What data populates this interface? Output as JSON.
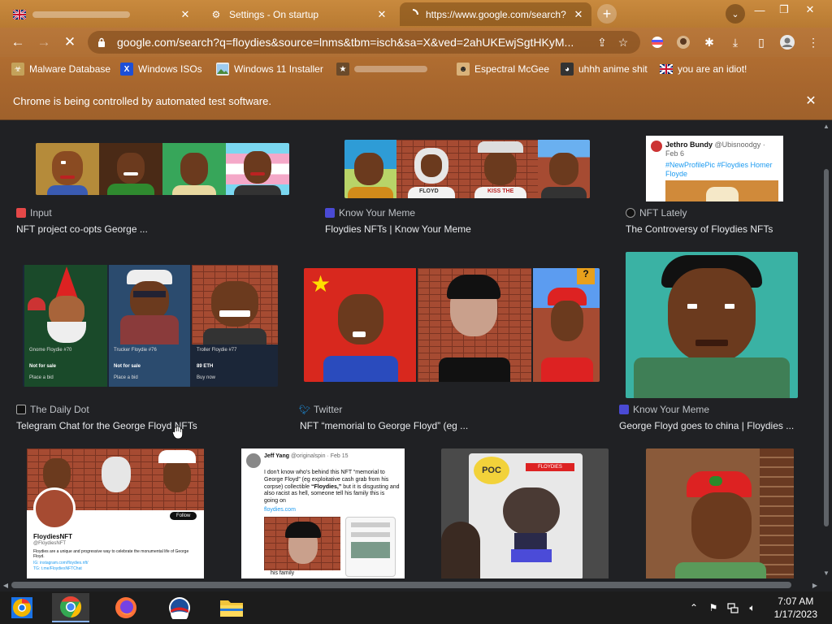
{
  "tabs": [
    {
      "title": "",
      "state": "background",
      "favicon": "flag-icon"
    },
    {
      "title": "Settings - On startup",
      "state": "background",
      "favicon": "gear-icon"
    },
    {
      "title": "https://www.google.com/search?",
      "state": "active-loading",
      "favicon": "spinner-icon"
    }
  ],
  "toolbar": {
    "url": "google.com/search?q=floydies&source=lnms&tbm=isch&sa=X&ved=2ahUKEwjSgtHKyM..."
  },
  "bookmarks": [
    {
      "label": "Malware Database",
      "icon": "malware-icon",
      "color": "#c4a25a"
    },
    {
      "label": "Windows ISOs",
      "icon": "x-icon",
      "color": "#1c4fd8"
    },
    {
      "label": "Windows 11 Installer",
      "icon": "image-icon",
      "color": "#4c8a3b"
    },
    {
      "label": "",
      "icon": "bookmark-icon",
      "color": "#6b4a2a"
    },
    {
      "label": "Espectral McGee",
      "icon": "face-icon",
      "color": "#d9b27a"
    },
    {
      "label": "uhhh anime shit",
      "icon": "anime-icon",
      "color": "#333333"
    },
    {
      "label": "you are an idiot!",
      "icon": "flag-icon",
      "color": "#c22"
    }
  ],
  "infobar": {
    "message": "Chrome is being controlled by automated test software."
  },
  "results": [
    {
      "source": "Input",
      "title": "NFT project co-opts George ...",
      "source_icon": "input-icon",
      "source_color": "#e54848"
    },
    {
      "source": "Know Your Meme",
      "title": "Floydies NFTs | Know Your Meme",
      "source_icon": "kym-icon",
      "source_color": "#4a4ad4"
    },
    {
      "source": "NFT Lately",
      "title": "The Controversy of Floydies NFTs",
      "source_icon": "nft-lately-icon",
      "source_color": "#111111"
    },
    {
      "source": "The Daily Dot",
      "title": "Telegram Chat for the George Floyd NFTs",
      "source_icon": "daily-dot-icon",
      "source_color": "#111111"
    },
    {
      "source": "Twitter",
      "title": "NFT “memorial to George Floyd” (eg ...",
      "source_icon": "twitter-icon",
      "source_color": "#1d9bf0"
    },
    {
      "source": "Know Your Meme",
      "title": "George Floyd goes to china | Floydies ...",
      "source_icon": "kym-icon",
      "source_color": "#4a4ad4"
    }
  ],
  "thumb_text": {
    "tweet_top": {
      "user": "Jethro Bundy",
      "handle": "@Ubisnoodgy · Feb 6",
      "body": "#NewProfilePic #Floydies Homer Floyde"
    },
    "tile_labels": [
      "Gnome Floydie #70",
      "Trucker Floydie #76",
      "Troller Floydie #77"
    ],
    "tile_status": [
      "Not for sale",
      "Not for sale",
      "89 ETH"
    ],
    "tile_actions": [
      "Place a bid",
      "Place a bid",
      "Buy now"
    ],
    "floyd_label": "FLOYD",
    "kiss_label": "KISS THE",
    "profile": {
      "name": "FloydiesNFT",
      "handle": "@FloydiesNFT",
      "follow": "Follow",
      "bio": "Floydies are a unique and progressive way to celebrate the monumental life of George Floyd.",
      "ig": "IG: instagram.com/floydies.nft/",
      "tg": "TG: t.me/FloydiesNFTChat"
    },
    "tweet_jeff": {
      "user": "Jeff Yang",
      "handle": "@originalspin · Feb 15",
      "body1": "I don't know who's behind this NFT “memorial to George Floyd” (eg exploitative cash grab from his corpse) collectible ",
      "bold": "“Floydies,”",
      "body2": " but it is disgusting and also racist as hell, someone tell his family this is going on",
      "link": "floydies.com",
      "footer": "his family"
    },
    "funko_logo": "POC",
    "funko_box": "FLOYDIES"
  },
  "taskbar": {
    "apps": [
      "chrome-canary-icon",
      "chrome-icon",
      "firefox-icon",
      "obama-icon",
      "file-explorer-icon"
    ],
    "time": "7:07 AM",
    "date": "1/17/2023"
  }
}
